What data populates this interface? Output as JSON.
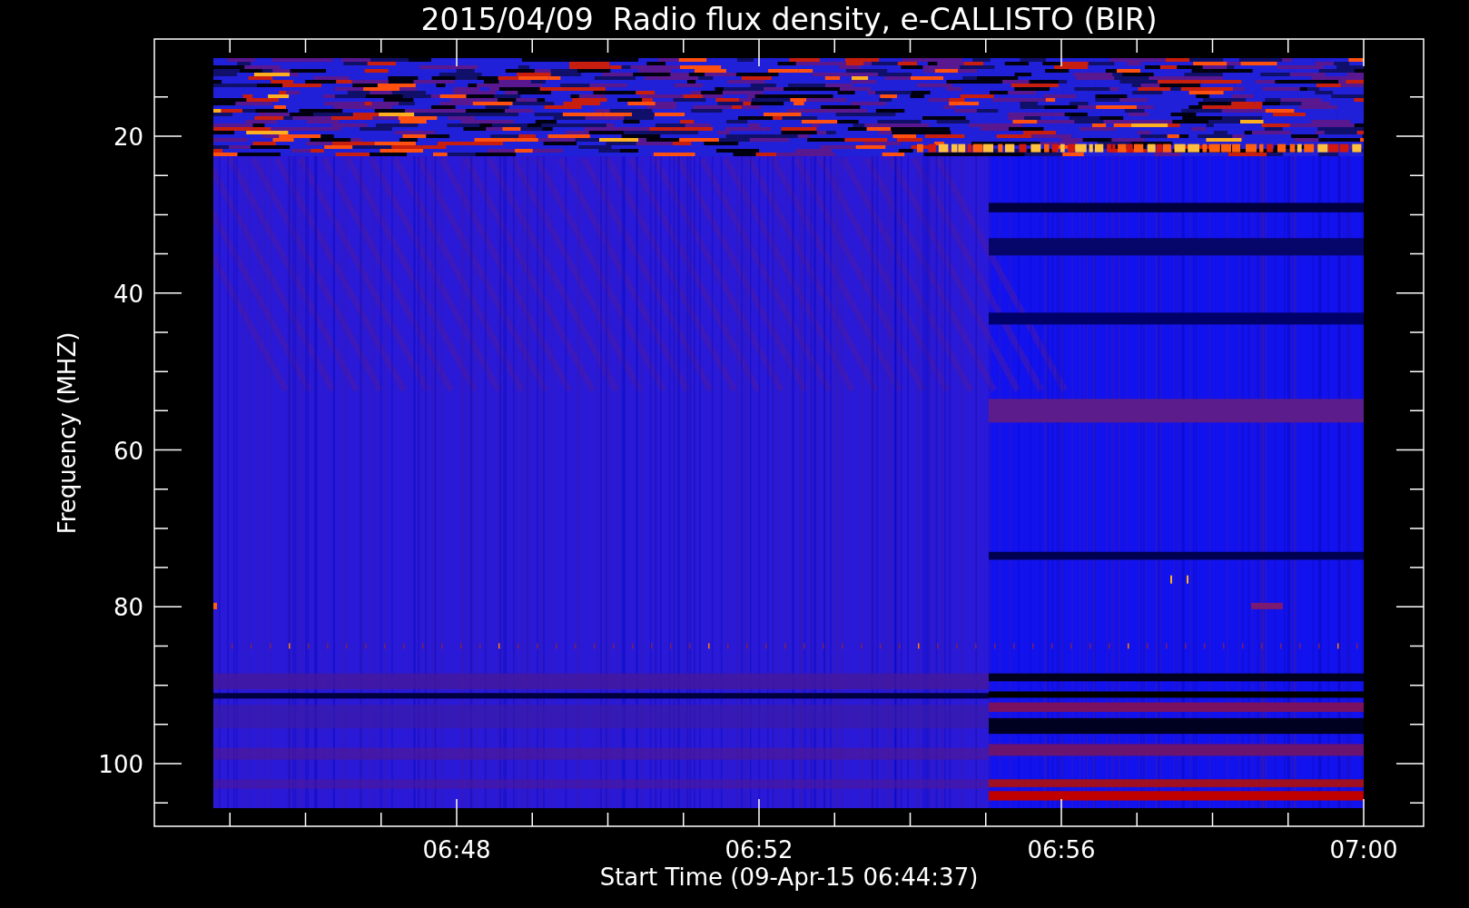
{
  "title": "2015/04/09  Radio flux density, e-CALLISTO (BIR)",
  "y_axis": {
    "label": "Frequency (MHZ)",
    "ticks": [
      "20",
      "40",
      "60",
      "80",
      "100"
    ]
  },
  "x_axis": {
    "label": "Start Time (09-Apr-15 06:44:37)",
    "ticks": [
      "06:48",
      "06:52",
      "06:56",
      "07:00"
    ]
  }
}
